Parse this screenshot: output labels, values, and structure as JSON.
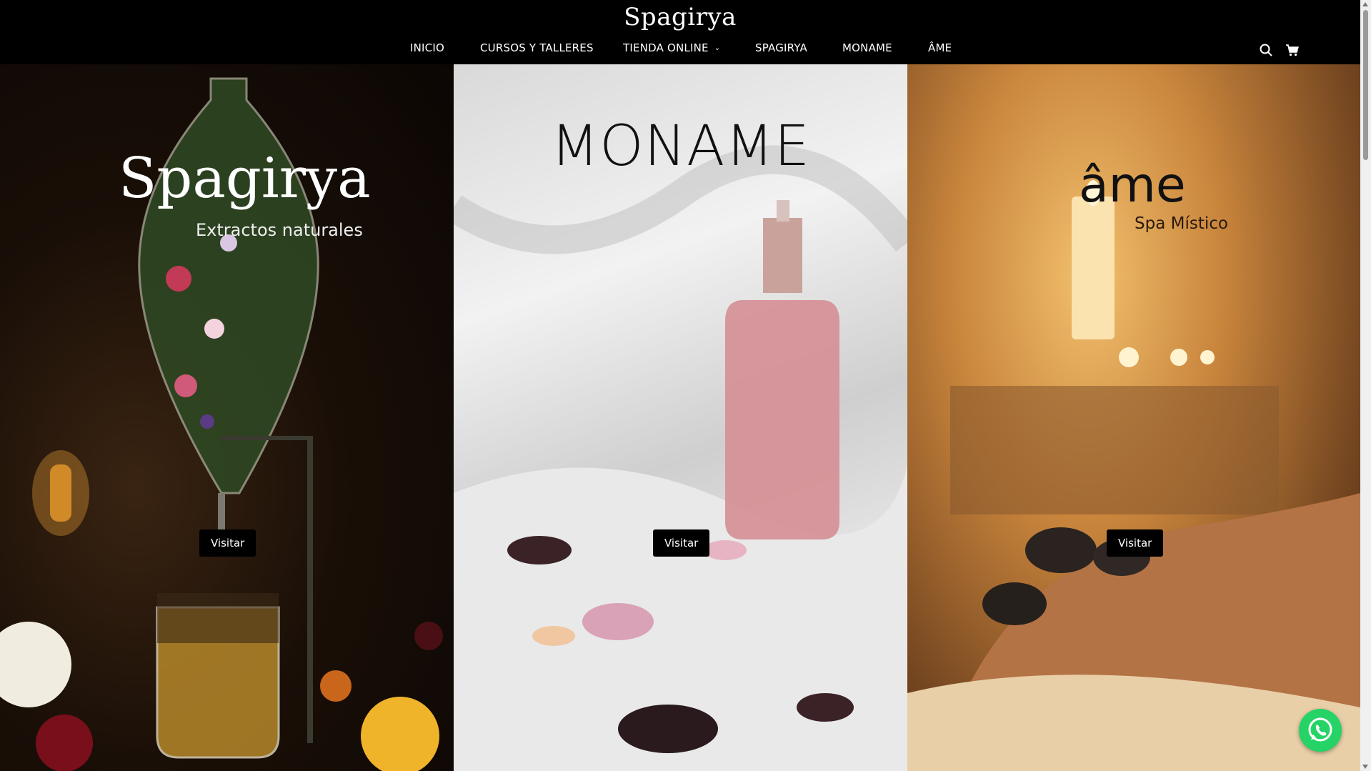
{
  "header": {
    "logo": "Spagirya",
    "nav": [
      {
        "label": "INICIO"
      },
      {
        "label": "CURSOS Y TALLERES"
      },
      {
        "label": "TIENDA ONLINE",
        "has_dropdown": true
      },
      {
        "label": "SPAGIRYA"
      },
      {
        "label": "MONAME"
      },
      {
        "label": "ÂME"
      }
    ],
    "icons": [
      "search-icon",
      "cart-icon"
    ]
  },
  "panels": [
    {
      "title": "Spagirya",
      "subtitle": "Extractos naturales",
      "button": "Visitar"
    },
    {
      "title": "MONAME",
      "button": "Visitar"
    },
    {
      "title": "âme",
      "subtitle": "Spa Místico",
      "button": "Visitar"
    }
  ],
  "floating": {
    "icon": "whatsapp-icon"
  },
  "colors": {
    "header_bg": "#000000",
    "button_bg": "#000000",
    "whatsapp": "#25d366"
  }
}
